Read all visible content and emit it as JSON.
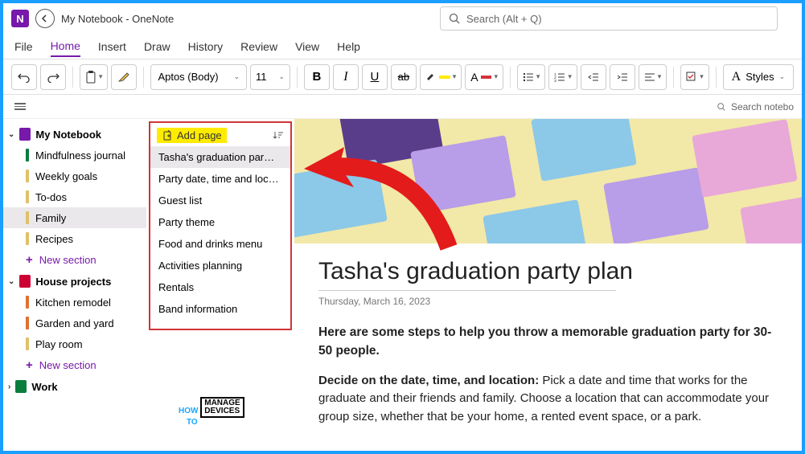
{
  "titlebar": {
    "title": "My Notebook - OneNote"
  },
  "search": {
    "placeholder": "Search (Alt + Q)"
  },
  "menubar": [
    "File",
    "Home",
    "Insert",
    "Draw",
    "History",
    "Review",
    "View",
    "Help"
  ],
  "menubar_active": 1,
  "ribbon": {
    "font": "Aptos (Body)",
    "size": "11",
    "styles_label": "Styles"
  },
  "search_notebook": {
    "label": "Search notebo"
  },
  "nav": {
    "notebooks": [
      {
        "name": "My Notebook",
        "icon_color": "#7719aa",
        "expanded": true,
        "sections": [
          {
            "name": "Mindfulness journal",
            "color": "#0a7d3e"
          },
          {
            "name": "Weekly goals",
            "color": "#e0c068"
          },
          {
            "name": "To-dos",
            "color": "#e0c068"
          },
          {
            "name": "Family",
            "color": "#e0c068",
            "selected": true
          },
          {
            "name": "Recipes",
            "color": "#e0c068"
          }
        ],
        "new_section": "New section"
      },
      {
        "name": "House projects",
        "icon_color": "#c03",
        "expanded": true,
        "sections": [
          {
            "name": "Kitchen remodel",
            "color": "#e07030"
          },
          {
            "name": "Garden and yard",
            "color": "#e07030"
          },
          {
            "name": "Play room",
            "color": "#e0c068"
          }
        ],
        "new_section": "New section"
      },
      {
        "name": "Work",
        "icon_color": "#0a7d3e",
        "expanded": false,
        "sections": []
      }
    ]
  },
  "pages": {
    "add_label": "Add page",
    "items": [
      {
        "title": "Tasha's graduation par…",
        "selected": true
      },
      {
        "title": "Party date, time and locat…"
      },
      {
        "title": "Guest list"
      },
      {
        "title": "Party theme"
      },
      {
        "title": "Food and drinks menu"
      },
      {
        "title": "Activities planning"
      },
      {
        "title": "Rentals"
      },
      {
        "title": "Band information"
      }
    ]
  },
  "content": {
    "title": "Tasha's graduation party plan",
    "date": "Thursday, March 16, 2023",
    "intro": "Here are some steps to help you throw a memorable graduation party for 30-50 people.",
    "para1_label": "Decide on the date, time, and location:",
    "para1_body": " Pick a date and time that works for the graduate and their friends and family. Choose a location that can accommodate your group size, whether that be your home, a rented event space, or a park."
  },
  "watermark": {
    "how": "HOW",
    "to": "TO",
    "manage": "MANAGE",
    "devices": "DEVICES"
  }
}
